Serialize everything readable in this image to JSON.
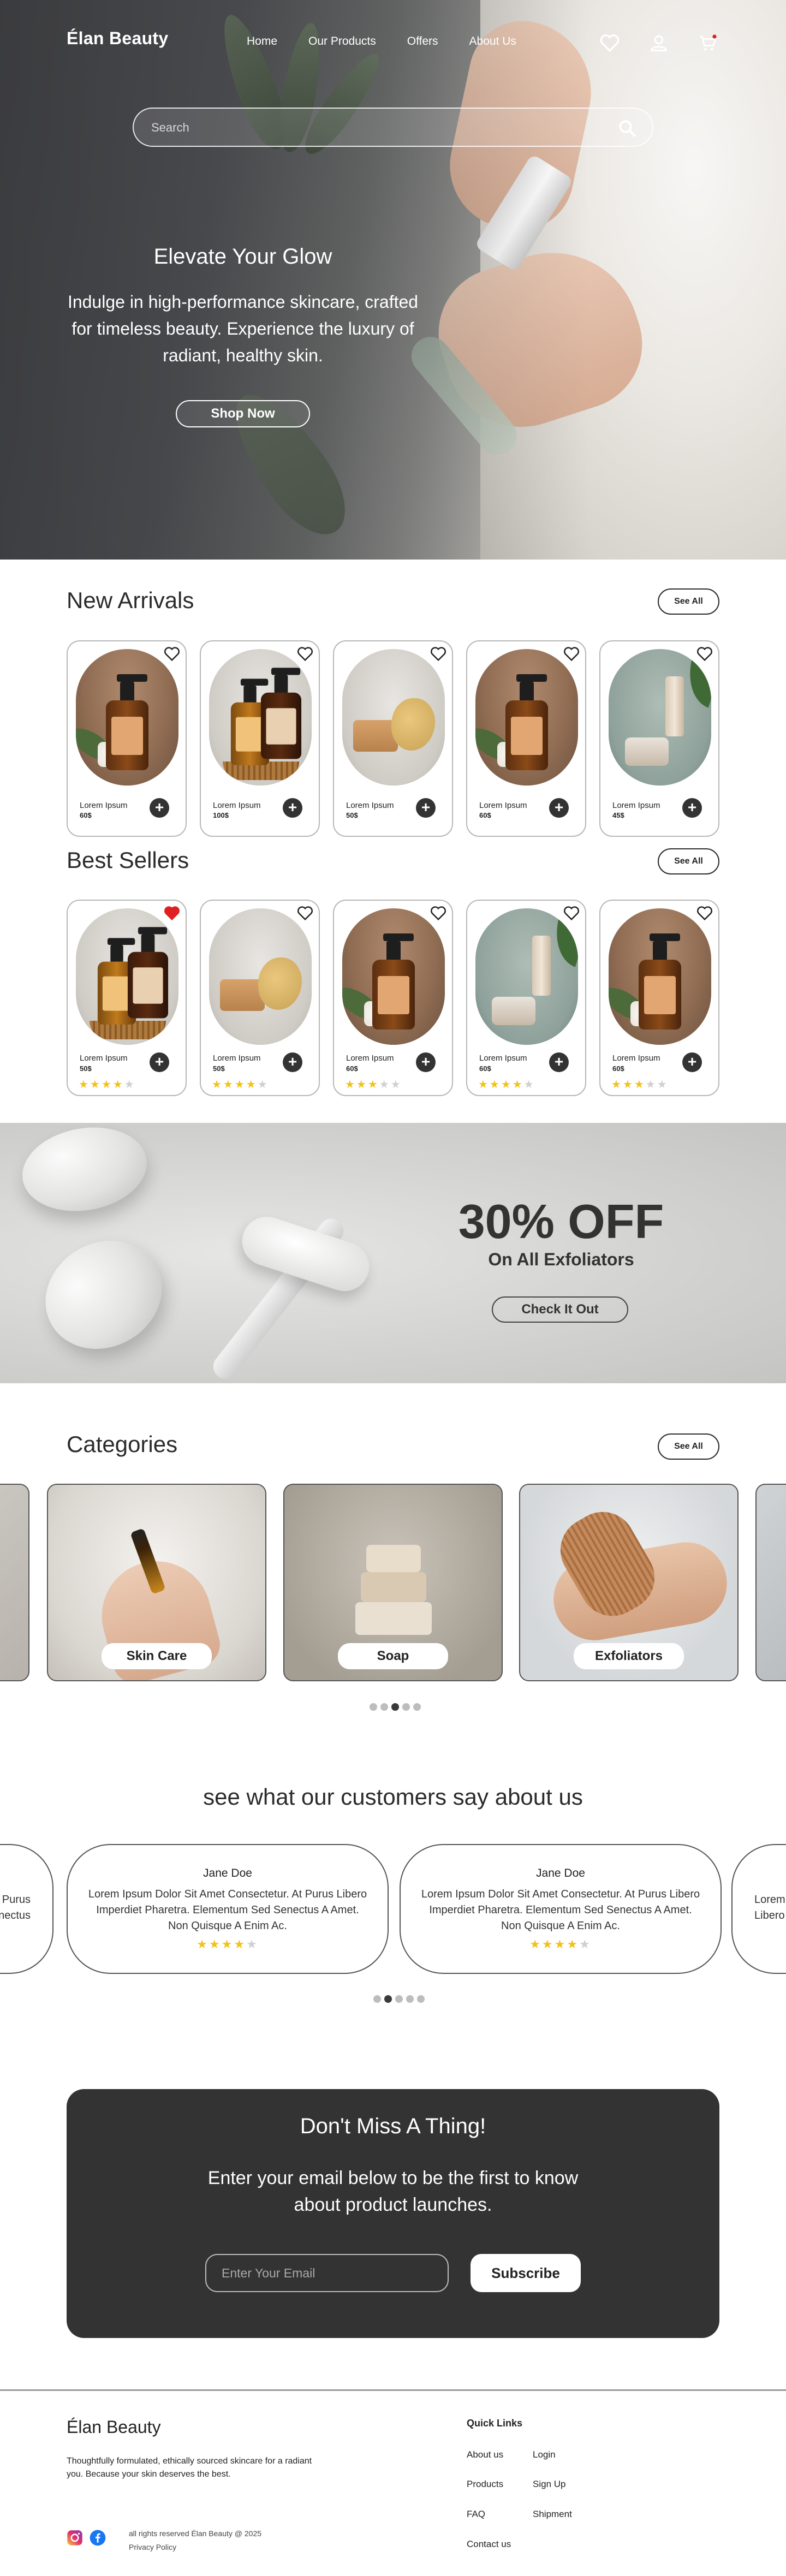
{
  "brand": "Élan Beauty",
  "nav": {
    "links": [
      "Home",
      "Our Products",
      "Offers",
      "About Us"
    ],
    "icons": [
      "heart-icon",
      "user-icon",
      "cart-icon"
    ]
  },
  "search": {
    "placeholder": "Search"
  },
  "hero": {
    "title": "Elevate Your Glow",
    "subtitle": "Indulge in high-performance skincare, crafted for timeless beauty. Experience the luxury of radiant, healthy skin.",
    "button": "Shop Now"
  },
  "new_arrivals": {
    "title": "New Arrivals",
    "see_all": "See All",
    "items": [
      {
        "name": "Lorem Ipsum",
        "price": "60$"
      },
      {
        "name": "Lorem Ipsum",
        "price": "100$"
      },
      {
        "name": "Lorem Ipsum",
        "price": "50$"
      },
      {
        "name": "Lorem Ipsum",
        "price": "60$"
      },
      {
        "name": "Lorem Ipsum",
        "price": "45$"
      }
    ]
  },
  "best_sellers": {
    "title": "Best Sellers",
    "see_all": "See All",
    "items": [
      {
        "name": "Lorem Ipsum",
        "price": "50$",
        "rating": 4,
        "favorited": true
      },
      {
        "name": "Lorem Ipsum",
        "price": "50$",
        "rating": 4,
        "favorited": false
      },
      {
        "name": "Lorem Ipsum",
        "price": "60$",
        "rating": 3,
        "favorited": false
      },
      {
        "name": "Lorem Ipsum",
        "price": "60$",
        "rating": 4,
        "favorited": false
      },
      {
        "name": "Lorem Ipsum",
        "price": "60$",
        "rating": 3,
        "favorited": false
      }
    ]
  },
  "promo": {
    "headline": "30% OFF",
    "sub": "On All Exfoliators",
    "button": "Check It Out"
  },
  "categories": {
    "title": "Categories",
    "see_all": "See All",
    "items": [
      "Skin Care",
      "Soap",
      "Exfoliators"
    ],
    "dots_active": 3
  },
  "testimonials": {
    "title": "see what our customers say about us",
    "items": [
      {
        "name": "Jane Doe",
        "text": "Lorem Ipsum Dolor Sit Amet Consectetur. At Purus Libero Imperdiet Pharetra. Elementum Sed Senectus A Amet. Non Quisque A Enim Ac.",
        "rating": 4
      },
      {
        "name": "Jane Doe",
        "text": "Lorem Ipsum Dolor Sit Amet Consectetur. At Purus Libero Imperdiet Pharetra. Elementum Sed Senectus A Amet. Non Quisque A Enim Ac.",
        "rating": 4
      }
    ],
    "partial_left": "Purus\nSenectus",
    "partial_right": "Lorem\nLibero",
    "dots_active": 2
  },
  "newsletter": {
    "title": "Don't Miss A Thing!",
    "sub": "Enter your email below to be the first to know about product launches.",
    "placeholder": "Enter Your Email",
    "button": "Subscribe"
  },
  "footer": {
    "brand": "Élan Beauty",
    "description": "Thoughtfully formulated, ethically sourced skincare for a radiant you. Because your skin deserves the best.",
    "copyright": "all rights reserved Élan Beauty @ 2025",
    "privacy": "Privacy Policy",
    "quick_links_title": "Quick Links",
    "links_col1": [
      "About us",
      "Products",
      "FAQ",
      "Contact us"
    ],
    "links_col2": [
      "Login",
      "Sign Up",
      "Shipment"
    ]
  },
  "colors": {
    "accent_dark": "#333333",
    "star": "#f2c218",
    "heart_active": "#e02020"
  }
}
